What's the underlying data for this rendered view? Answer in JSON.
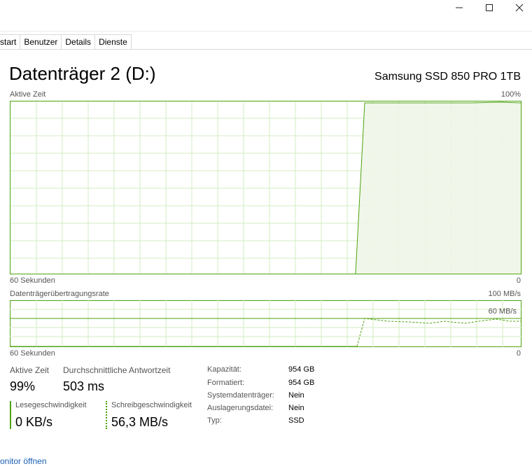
{
  "window": {
    "minimize_icon": "minimize-icon",
    "maximize_icon": "maximize-icon",
    "close_icon": "close-icon"
  },
  "tabs": [
    "start",
    "Benutzer",
    "Details",
    "Dienste"
  ],
  "disk": {
    "title": "Datenträger 2 (D:)",
    "model": "Samsung SSD 850 PRO 1TB"
  },
  "active_time_graph": {
    "label": "Aktive Zeit",
    "max_label": "100%",
    "time_label": "60 Sekunden",
    "min_label": "0"
  },
  "transfer_graph": {
    "label": "Datenträgerübertragungsrate",
    "max_label": "100 MB/s",
    "mid_label": "60 MB/s",
    "time_label": "60 Sekunden",
    "min_label": "0"
  },
  "stats": {
    "active_time_label": "Aktive Zeit",
    "active_time_value": "99%",
    "response_label": "Durchschnittliche Antwortzeit",
    "response_value": "503 ms",
    "read_label": "Lesegeschwindigkeit",
    "read_value": "0 KB/s",
    "write_label": "Schreibgeschwindigkeit",
    "write_value": "56,3 MB/s"
  },
  "properties": [
    {
      "label": "Kapazität:",
      "value": "954 GB"
    },
    {
      "label": "Formatiert:",
      "value": "954 GB"
    },
    {
      "label": "Systemdatenträger:",
      "value": "Nein"
    },
    {
      "label": "Auslagerungsdatei:",
      "value": "Nein"
    },
    {
      "label": "Typ:",
      "value": "SSD"
    }
  ],
  "link": "onitor öffnen",
  "colors": {
    "accent": "#4da30f",
    "fill": "#edf6e6",
    "grid": "#d3ecc2"
  }
}
